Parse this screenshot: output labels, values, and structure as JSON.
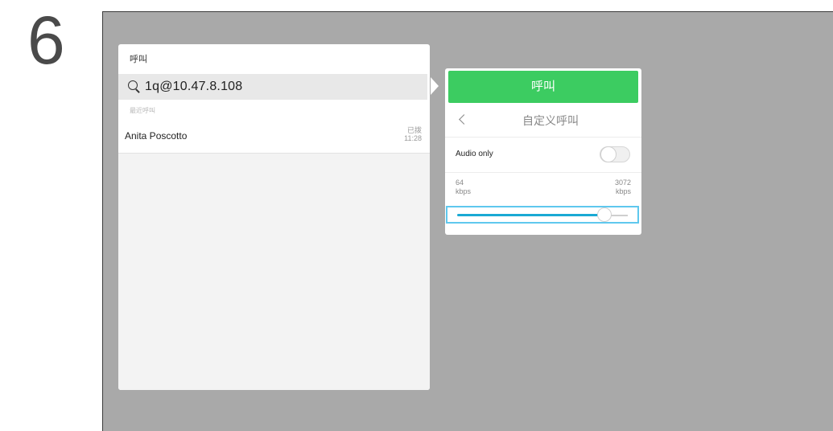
{
  "step": {
    "number": "6"
  },
  "call_panel": {
    "title": "呼叫",
    "search": {
      "icon": "search-icon",
      "value": "1q@10.47.8.108"
    },
    "recent_label": "最近呼叫",
    "recents": [
      {
        "name": "Anita Poscotto",
        "status": "已拨",
        "time": "11:28"
      }
    ]
  },
  "popup": {
    "call_button": "呼叫",
    "back_icon": "chevron-left-icon",
    "title": "自定义呼叫",
    "audio_only": {
      "label": "Audio only",
      "on": false
    },
    "bitrate": {
      "min_value": "64",
      "min_unit": "kbps",
      "max_value": "3072",
      "max_unit": "kbps",
      "level_fraction": 0.92
    }
  },
  "colors": {
    "call_green": "#3ccc61",
    "slider_blue": "#1aa9d4",
    "focus_outline": "#5fc8ee",
    "screen_gray": "#a9a9a9"
  }
}
